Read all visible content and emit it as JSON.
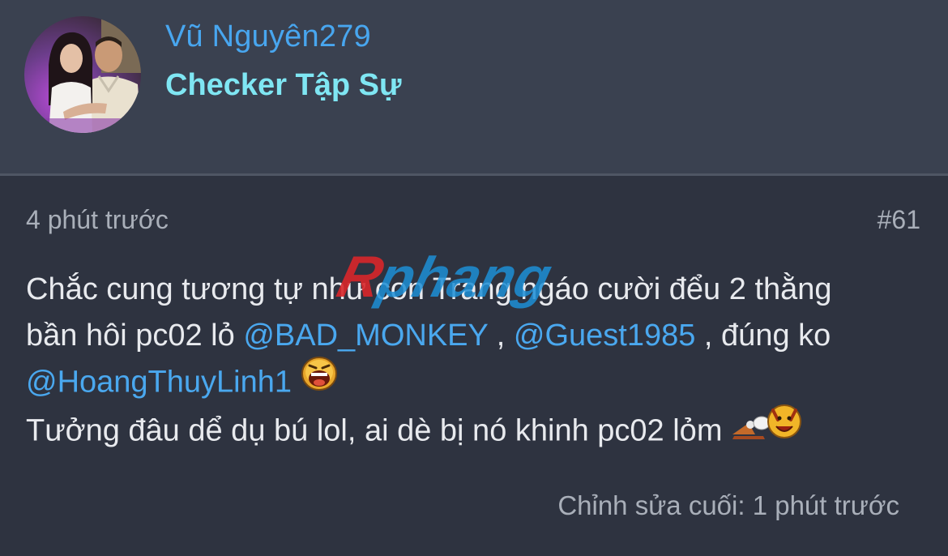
{
  "user": {
    "name": "Vũ Nguyên279",
    "title": "Checker Tập Sự"
  },
  "post": {
    "time": "4 phút trước",
    "number": "#61",
    "line1": "Chắc cung tương tự như con Trang ngáo cười đểu 2 thằng",
    "line2_prefix": "bần hôi pc02 lỏ ",
    "mention1": "@BAD_MONKEY",
    "line2_sep": " , ",
    "mention2": "@Guest1985",
    "line2_suffix": " , đúng ko",
    "mention3": "@HoangThuyLinh1",
    "line4": "Tưởng đâu dể dụ bú lol, ai dè bị nó khinh pc02 lỏm",
    "edited": "Chỉnh sửa cuối: 1 phút trước"
  },
  "watermark": {
    "text": "Rphang"
  },
  "icons": {
    "laugh_emoji": "laughing-face-icon",
    "taunt_emoji": "taunt-smiley-icon"
  },
  "colors": {
    "mention": "#4aa8ef",
    "username": "#48a6ef",
    "user_title": "#7fe6f3",
    "watermark_red": "#d8262a",
    "watermark_blue": "#1d8fd6"
  }
}
